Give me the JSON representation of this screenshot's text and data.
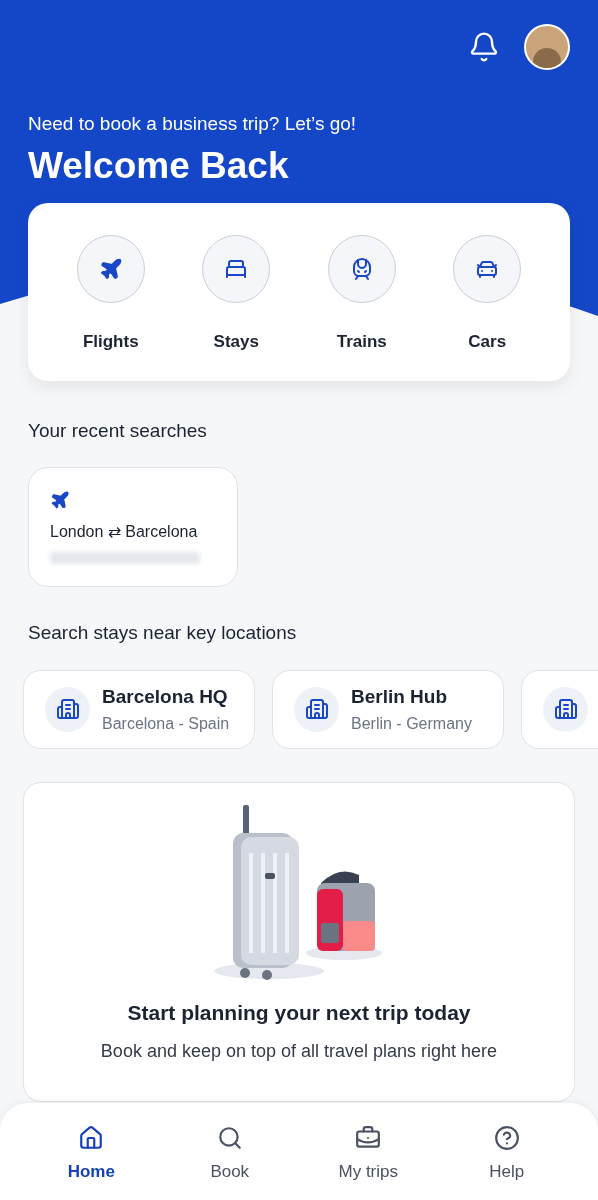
{
  "header": {
    "subtitle": "Need to book a business trip? Let’s go!",
    "title": "Welcome Back"
  },
  "categories": [
    {
      "kind": "flight",
      "label": "Flights"
    },
    {
      "kind": "stay",
      "label": "Stays"
    },
    {
      "kind": "train",
      "label": "Trains"
    },
    {
      "kind": "car",
      "label": "Cars"
    }
  ],
  "recent_searches": {
    "heading": "Your recent searches",
    "items": [
      {
        "kind": "flight",
        "route_from": "London",
        "route_arrow": "⇄",
        "route_to": "Barcelona"
      }
    ]
  },
  "locations": {
    "heading": "Search stays near key locations",
    "items": [
      {
        "kind": "location",
        "name": "Barcelona HQ",
        "place": "Barcelona - Spain"
      },
      {
        "kind": "location",
        "name": "Berlin Hub",
        "place": "Berlin - Germany"
      },
      {
        "kind": "cut_off"
      }
    ]
  },
  "promo": {
    "title": "Start planning your next trip today",
    "text": "Book and keep on top of all travel plans right here"
  },
  "nav": [
    {
      "kind": "home",
      "label": "Home",
      "selected": true
    },
    {
      "kind": "search",
      "label": "Book",
      "selected": false
    },
    {
      "kind": "trips",
      "label": "My trips",
      "selected": false
    },
    {
      "kind": "help",
      "label": "Help",
      "selected": false
    }
  ]
}
